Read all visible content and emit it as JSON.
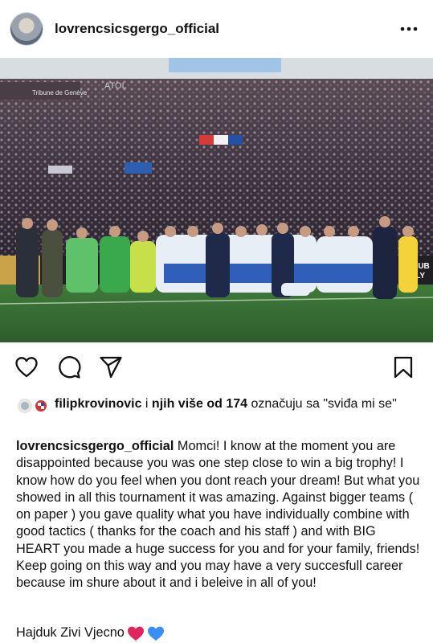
{
  "post": {
    "username": "lovrencsicsgergo_official",
    "likes_user": "filipkrovinovic",
    "likes_connector": " i ",
    "likes_count_text": "njih više od 174",
    "likes_suffix": " označuju sa \"sviđa mi se\"",
    "caption_user": "lovrencsicsgergo_official",
    "caption_text": " Momci! I know at the moment you are disappointed because you was one step close to win a big trophy! I know how do you feel when you dont reach  your dream! But what you showed in all this tournament it was amazing. Against bigger teams ( on paper ) you gave quality what you have individually combine with good tactics ( thanks for the coach and his staff ) and with BIG HEART you made a huge success for you and for your family, friends! Keep going on this way and you may have a very succesfull career because im shure about it and i beleive in all of you!",
    "closing_text": "Hajduk Zivi Vjecno",
    "heart_colors": [
      "#e0245e",
      "#3a8ef6"
    ]
  },
  "photo": {
    "banner_text": "CLUB",
    "banner_text_2": "ULY",
    "stand_text": "Tribune de Genève",
    "board_text": "ATOL"
  },
  "icons": [
    "more-icon",
    "heart-icon",
    "comment-icon",
    "share-icon",
    "bookmark-icon"
  ]
}
